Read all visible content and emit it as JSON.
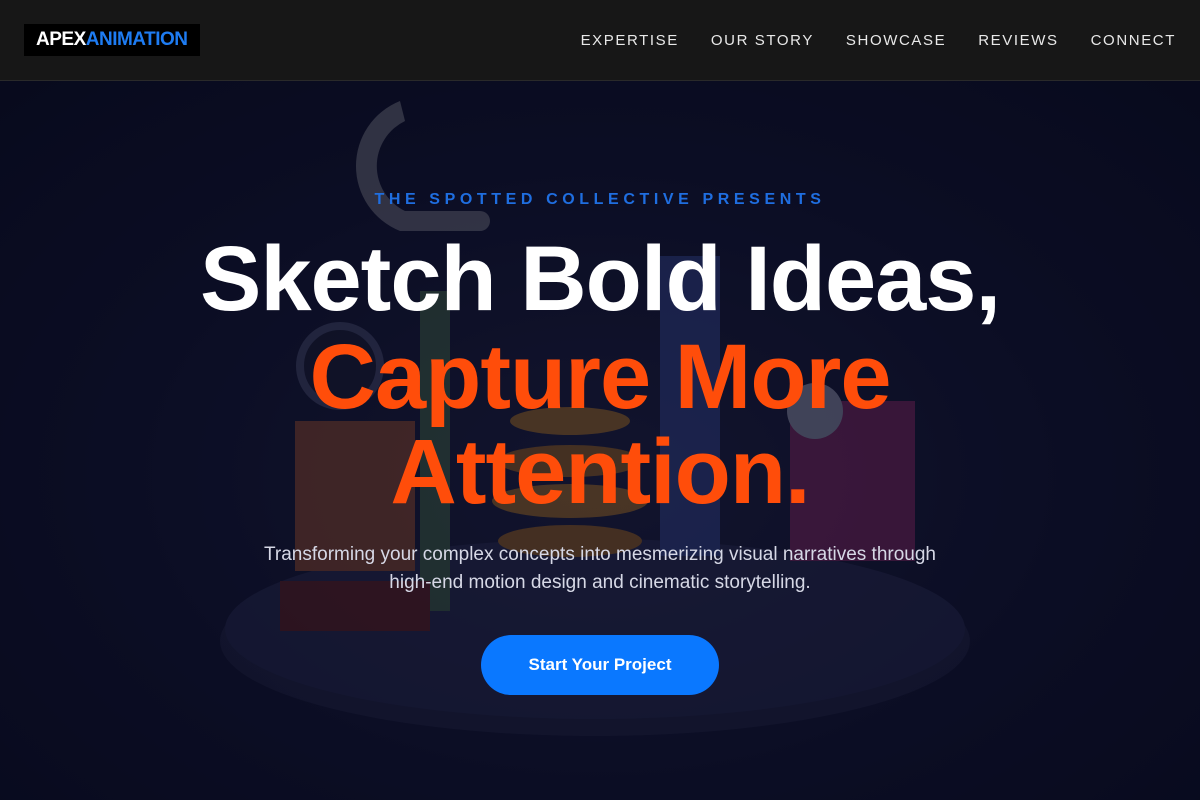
{
  "header": {
    "logo": {
      "part1": "APEX",
      "part2": "ANIMATION"
    },
    "nav": [
      {
        "label": "EXPERTISE"
      },
      {
        "label": "OUR STORY"
      },
      {
        "label": "SHOWCASE"
      },
      {
        "label": "REVIEWS"
      },
      {
        "label": "CONNECT"
      }
    ]
  },
  "hero": {
    "eyebrow": "THE SPOTTED COLLECTIVE PRESENTS",
    "headline_line1": "Sketch Bold Ideas,",
    "headline_line2": "Capture More",
    "headline_line3": "Attention.",
    "subtitle": "Transforming your complex concepts into mesmerizing visual narratives through high-end motion design and cinematic storytelling.",
    "cta_label": "Start Your Project"
  },
  "colors": {
    "header_bg": "#171717",
    "accent_blue": "#1e7cf2",
    "accent_orange": "#ff4d0a",
    "cta_blue": "#0a78ff",
    "hero_bg": "#0e1029"
  }
}
